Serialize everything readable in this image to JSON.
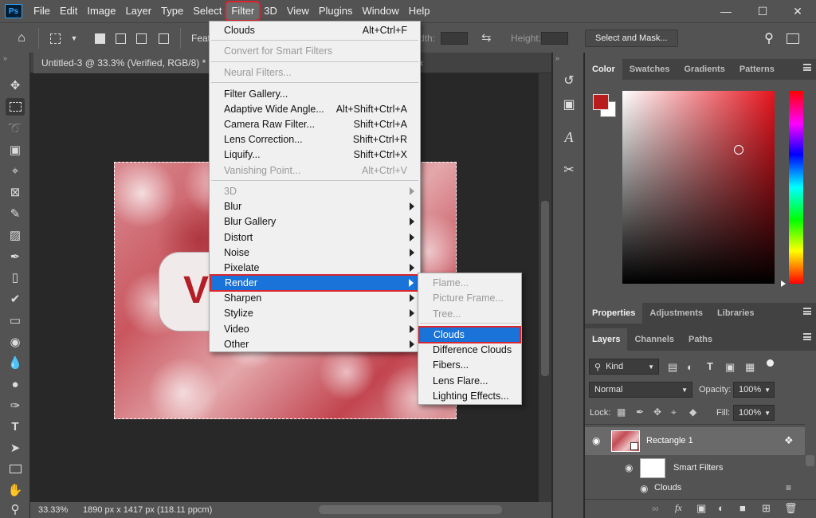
{
  "app": {
    "logo": "Ps"
  },
  "menubar": {
    "items": [
      "File",
      "Edit",
      "Image",
      "Layer",
      "Type",
      "Select",
      "Filter",
      "3D",
      "View",
      "Plugins",
      "Window",
      "Help"
    ],
    "active": "Filter"
  },
  "window_controls": [
    "minimize-icon",
    "maximize-icon",
    "close-icon"
  ],
  "options_bar": {
    "feather_label": "Feat",
    "width_label": "Width:",
    "height_label": "Height:",
    "select_mask_button": "Select and Mask..."
  },
  "document": {
    "tab_title": "Untitled-3 @ 33.3% (Verified, RGB/8) *",
    "close_symbol": "×",
    "artwork_letter": "V"
  },
  "status_bar": {
    "zoom": "33.33%",
    "doc_info": "1890 px x 1417 px (118.11 ppcm)"
  },
  "filter_menu": {
    "items": [
      {
        "label": "Clouds",
        "shortcut": "Alt+Ctrl+F"
      },
      {
        "label": "Convert for Smart Filters",
        "disabled": true
      },
      {
        "label": "Neural Filters...",
        "disabled": true
      },
      {
        "label": "Filter Gallery..."
      },
      {
        "label": "Adaptive Wide Angle...",
        "shortcut": "Alt+Shift+Ctrl+A"
      },
      {
        "label": "Camera Raw Filter...",
        "shortcut": "Shift+Ctrl+A"
      },
      {
        "label": "Lens Correction...",
        "shortcut": "Shift+Ctrl+R"
      },
      {
        "label": "Liquify...",
        "shortcut": "Shift+Ctrl+X"
      },
      {
        "label": "Vanishing Point...",
        "shortcut": "Alt+Ctrl+V",
        "disabled": true
      },
      {
        "label": "3D",
        "submenu": true,
        "disabled": true
      },
      {
        "label": "Blur",
        "submenu": true
      },
      {
        "label": "Blur Gallery",
        "submenu": true
      },
      {
        "label": "Distort",
        "submenu": true
      },
      {
        "label": "Noise",
        "submenu": true
      },
      {
        "label": "Pixelate",
        "submenu": true
      },
      {
        "label": "Render",
        "submenu": true,
        "highlighted": true
      },
      {
        "label": "Sharpen",
        "submenu": true
      },
      {
        "label": "Stylize",
        "submenu": true
      },
      {
        "label": "Video",
        "submenu": true
      },
      {
        "label": "Other",
        "submenu": true
      }
    ]
  },
  "render_submenu": {
    "items": [
      {
        "label": "Flame...",
        "disabled": true
      },
      {
        "label": "Picture Frame...",
        "disabled": true
      },
      {
        "label": "Tree...",
        "disabled": true
      },
      {
        "label": "Clouds",
        "highlighted": true
      },
      {
        "label": "Difference Clouds"
      },
      {
        "label": "Fibers..."
      },
      {
        "label": "Lens Flare..."
      },
      {
        "label": "Lighting Effects..."
      }
    ]
  },
  "color_panel": {
    "tabs": [
      "Color",
      "Swatches",
      "Gradients",
      "Patterns"
    ],
    "foreground": "#b91c1c",
    "background": "#ffffff"
  },
  "properties_panel": {
    "tabs": [
      "Properties",
      "Adjustments",
      "Libraries"
    ]
  },
  "layers_panel": {
    "tabs": [
      "Layers",
      "Channels",
      "Paths"
    ],
    "filter_kind": "Kind",
    "blend_mode": "Normal",
    "opacity_label": "Opacity:",
    "opacity_value": "100%",
    "lock_label": "Lock:",
    "fill_label": "Fill:",
    "fill_value": "100%",
    "layers": [
      {
        "name": "Rectangle 1"
      },
      {
        "name": "Smart Filters"
      },
      {
        "name": "Clouds"
      }
    ]
  },
  "colors": {
    "accent": "#1a73d8",
    "highlight_outline": "#d9262f"
  }
}
